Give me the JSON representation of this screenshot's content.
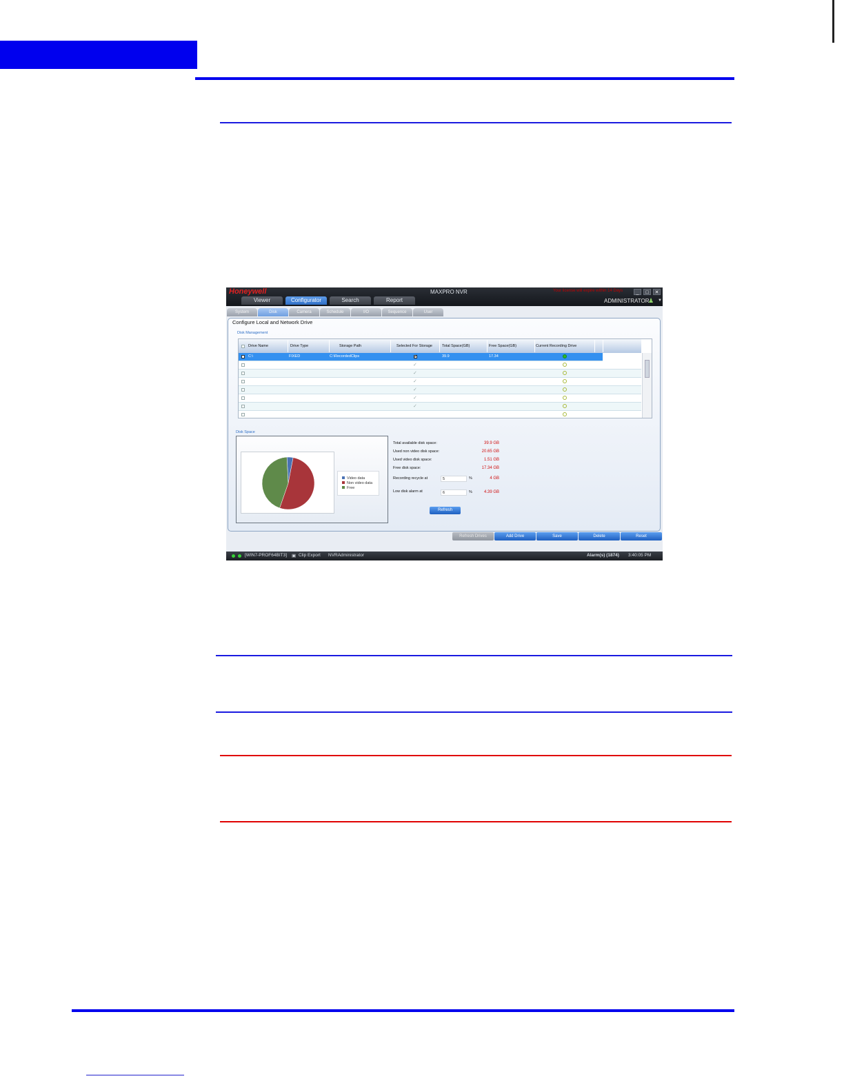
{
  "app": {
    "brand": "Honeywell",
    "title": "MAXPRO NVR",
    "license_message": "Your license will expire within 14 Days",
    "user": "ADMINISTRATOR",
    "window_buttons": [
      "_",
      "□",
      "✕"
    ]
  },
  "main_tabs": [
    {
      "label": "Viewer",
      "active": false
    },
    {
      "label": "Configurator",
      "active": true
    },
    {
      "label": "Search",
      "active": false
    },
    {
      "label": "Report",
      "active": false
    }
  ],
  "sub_tabs": [
    {
      "label": "System",
      "active": false
    },
    {
      "label": "Disk",
      "active": true
    },
    {
      "label": "Camera",
      "active": false
    },
    {
      "label": "Schedule",
      "active": false
    },
    {
      "label": "I/O",
      "active": false
    },
    {
      "label": "Sequence",
      "active": false
    },
    {
      "label": "User",
      "active": false
    }
  ],
  "panel": {
    "title": "Configure Local and Network Drive",
    "disk_management_label": "Disk Management",
    "disk_space_label": "Disk Space"
  },
  "grid": {
    "columns": [
      "Drive Name",
      "Drive Type",
      "Storage Path",
      "Selected For Storage",
      "Total Space(GB)",
      "Free Space(GB)",
      "Current Recording Drive"
    ],
    "rows": [
      {
        "drive_name": "C:\\",
        "drive_type": "FIXED",
        "storage_path": "C:\\RecordedClips",
        "total": "39.9",
        "free": "17.34",
        "selected": true,
        "recording": true
      }
    ],
    "empty_rows": 7
  },
  "chart_data": {
    "type": "pie",
    "categories": [
      "Video data",
      "Non video data",
      "Free"
    ],
    "values": [
      1.51,
      20.65,
      17.34
    ],
    "colors": [
      "#4a72b4",
      "#a8353a",
      "#5f8a4a"
    ]
  },
  "stats": {
    "total_label": "Total available disk space:",
    "total_value": "39.9  GB",
    "non_video_label": "Used non video disk space:",
    "non_video_value": "20.65  GB",
    "video_label": "Used video disk space:",
    "video_value": "1.51  GB",
    "free_label": "Free disk space:",
    "free_value": "17.34  GB",
    "recycle_label": "Recording recycle at",
    "recycle_input": "5",
    "recycle_unit": "%",
    "recycle_value": "4  GB",
    "alarm_label": "Low disk alarm at",
    "alarm_input": "6",
    "alarm_unit": "%",
    "alarm_value": "4.39  GB",
    "refresh_label": "Refresh"
  },
  "actions": [
    {
      "label": "Refresh Drives",
      "disabled": true
    },
    {
      "label": "Add Drive",
      "disabled": false
    },
    {
      "label": "Save",
      "disabled": false
    },
    {
      "label": "Delete",
      "disabled": false
    },
    {
      "label": "Reset",
      "disabled": false
    }
  ],
  "statusbar": {
    "machine": "[WIN7-PROF64BIT3]",
    "clip_export": "Clip Export",
    "user": "NVRAdministrator",
    "alarms": "Alarm(s) (1874)",
    "time": "3:40:05 PM"
  }
}
